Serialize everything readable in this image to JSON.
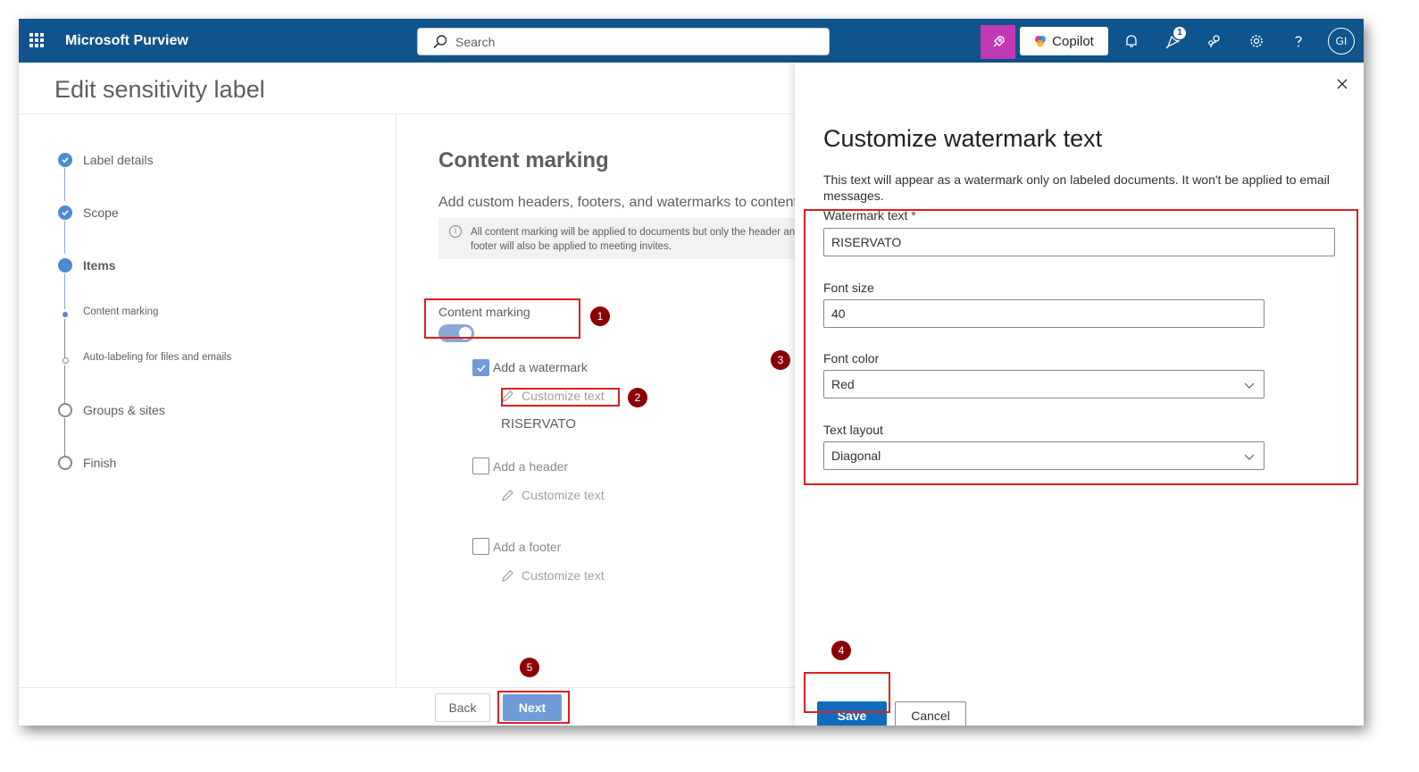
{
  "topbar": {
    "app_title": "Microsoft Purview",
    "search_placeholder": "Search",
    "copilot_label": "Copilot",
    "notification_count": "1",
    "avatar_initials": "GI"
  },
  "page": {
    "title": "Edit sensitivity label"
  },
  "steps": [
    {
      "label": "Label details",
      "state": "done"
    },
    {
      "label": "Scope",
      "state": "done"
    },
    {
      "label": "Items",
      "state": "current"
    },
    {
      "label": "Content marking",
      "state": "current-sub"
    },
    {
      "label": "Auto-labeling for files and emails",
      "state": "pending-sub"
    },
    {
      "label": "Groups & sites",
      "state": "pending"
    },
    {
      "label": "Finish",
      "state": "pending"
    }
  ],
  "content": {
    "heading": "Content marking",
    "description": "Add custom headers, footers, and watermarks to content",
    "info_text": "All content marking will be applied to documents but only the header and footer will also be applied to meeting invites.",
    "toggle_label": "Content marking",
    "toggle_on": true,
    "watermark": {
      "label": "Add a watermark",
      "checked": true,
      "customize": "Customize text",
      "value": "RISERVATO"
    },
    "header": {
      "label": "Add a header",
      "checked": false,
      "customize": "Customize text"
    },
    "footer": {
      "label": "Add a footer",
      "checked": false,
      "customize": "Customize text"
    }
  },
  "footer": {
    "back_label": "Back",
    "next_label": "Next"
  },
  "panel": {
    "title": "Customize watermark text",
    "description": "This text will appear as a watermark only on labeled documents. It won't be applied to email messages.",
    "watermark_text_label": "Watermark text",
    "required_mark": "*",
    "watermark_text_value": "RISERVATO",
    "font_size_label": "Font size",
    "font_size_value": "40",
    "font_color_label": "Font color",
    "font_color_value": "Red",
    "text_layout_label": "Text layout",
    "text_layout_value": "Diagonal",
    "save_label": "Save",
    "cancel_label": "Cancel"
  },
  "annotations": [
    "1",
    "2",
    "3",
    "4",
    "5"
  ],
  "colors": {
    "topbar": "#0f548c",
    "accent": "#0f6cbd",
    "annotation_box": "#d9201f",
    "annotation_marker": "#8b0000",
    "copilot_app": "#c239b3"
  }
}
